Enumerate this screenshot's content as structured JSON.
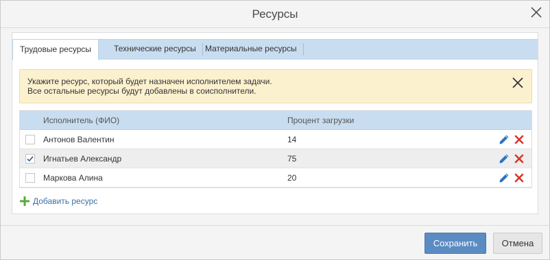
{
  "dialog": {
    "title": "Ресурсы",
    "close_icon": "close-icon"
  },
  "tabs": [
    {
      "label": "Трудовые ресурсы",
      "active": true
    },
    {
      "label": "Технические ресурсы",
      "active": false
    },
    {
      "label": "Материальные ресурсы",
      "active": false
    }
  ],
  "notice": {
    "line1": "Укажите ресурс, который будет назначен исполнителем задачи.",
    "line2": "Все остальные ресурсы будут добавлены в соисполнители.",
    "close_icon": "close-icon"
  },
  "grid": {
    "columns": {
      "name": "Исполнитель (ФИО)",
      "load": "Процент загрузки"
    },
    "rows": [
      {
        "name": "Антонов Валентин",
        "load": "14",
        "checked": false
      },
      {
        "name": "Игнатьев Александр",
        "load": "75",
        "checked": true
      },
      {
        "name": "Маркова Алина",
        "load": "20",
        "checked": false
      }
    ]
  },
  "add_resource": {
    "label": "Добавить ресурс",
    "icon": "plus-icon"
  },
  "footer": {
    "save_label": "Сохранить",
    "cancel_label": "Отмена"
  },
  "colors": {
    "accent": "#5b8bc3",
    "header_bg": "#c9ddf0",
    "notice_bg": "#fcf1cf",
    "edit_icon": "#2f74c0",
    "delete_icon": "#d9352c",
    "plus_icon": "#5aa83a"
  }
}
